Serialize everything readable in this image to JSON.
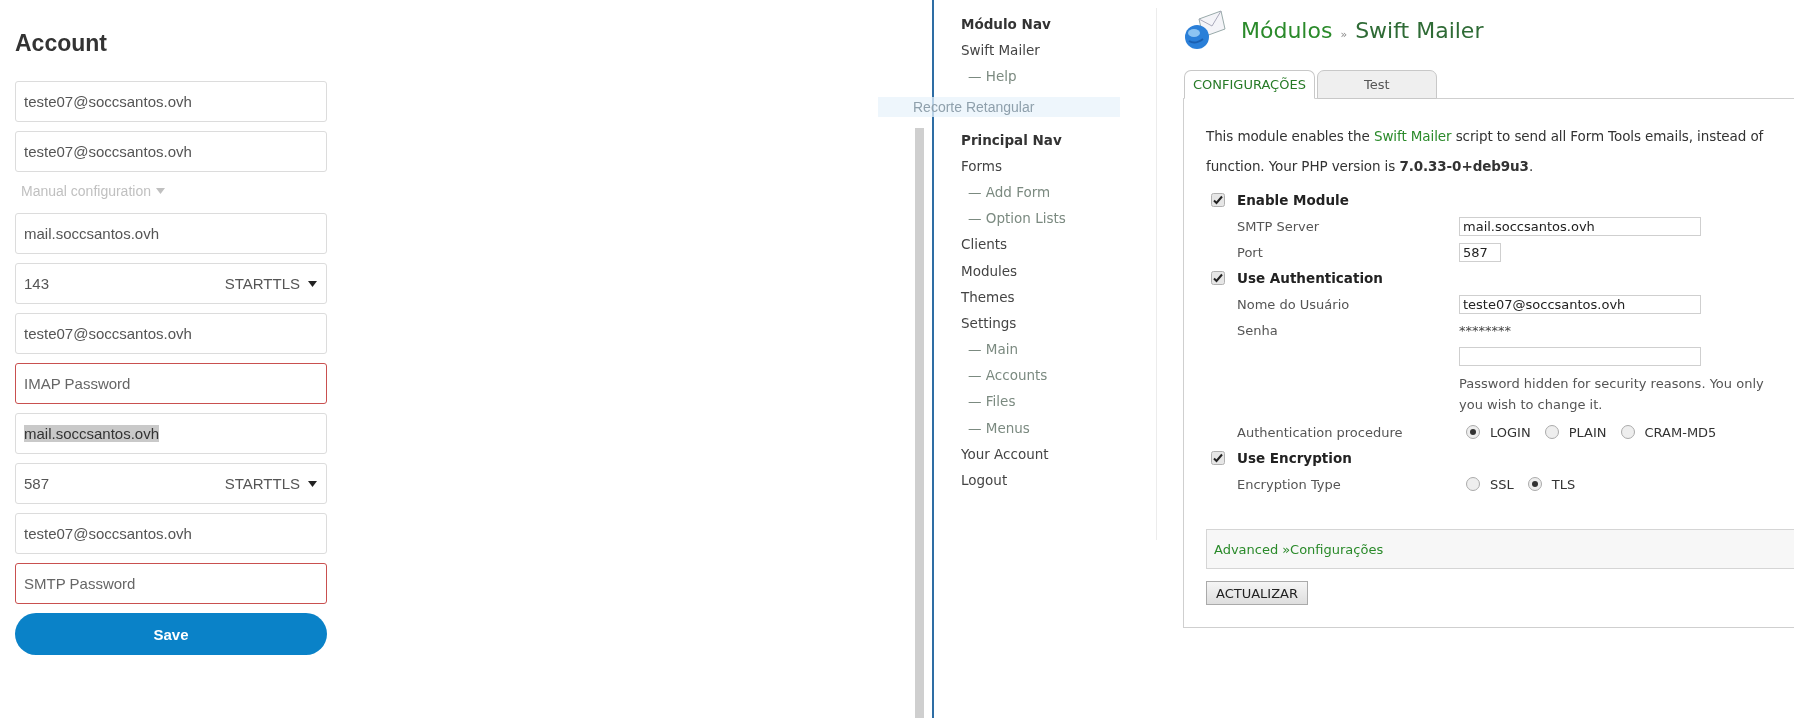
{
  "account": {
    "title": "Account",
    "fields": [
      {
        "kind": "text",
        "value": "teste07@soccsantos.ovh",
        "invalid": false,
        "highlighted": false
      },
      {
        "kind": "text",
        "value": "teste07@soccsantos.ovh",
        "invalid": false,
        "highlighted": false
      },
      {
        "kind": "toggle",
        "label": "Manual configuration"
      },
      {
        "kind": "text",
        "value": "mail.soccsantos.ovh",
        "invalid": false,
        "highlighted": false
      },
      {
        "kind": "port",
        "value": "143",
        "security": "STARTTLS",
        "invalid": false,
        "highlighted": false
      },
      {
        "kind": "text",
        "value": "teste07@soccsantos.ovh",
        "invalid": false,
        "highlighted": false
      },
      {
        "kind": "password",
        "placeholder": "IMAP Password",
        "invalid": true
      },
      {
        "kind": "text",
        "value": "mail.soccsantos.ovh",
        "invalid": false,
        "highlighted": true
      },
      {
        "kind": "port",
        "value": "587",
        "security": "STARTTLS",
        "invalid": false,
        "highlighted": false
      },
      {
        "kind": "text",
        "value": "teste07@soccsantos.ovh",
        "invalid": false,
        "highlighted": false
      },
      {
        "kind": "password",
        "placeholder": "SMTP Password",
        "invalid": true
      }
    ],
    "save_button": "Save"
  },
  "overlay_tooltip": {
    "text": "Recorte Retangular"
  },
  "nav": {
    "sections": [
      {
        "heading": "Módulo Nav",
        "items": [
          {
            "label": "Swift Mailer",
            "children": [
              {
                "label": "— Help"
              }
            ]
          }
        ]
      },
      {
        "heading": "Principal Nav",
        "items": [
          {
            "label": "Forms",
            "children": [
              {
                "label": "— Add Form"
              },
              {
                "label": "— Option Lists"
              }
            ]
          },
          {
            "label": "Clients"
          },
          {
            "label": "Modules"
          },
          {
            "label": "Themes"
          },
          {
            "label": "Settings",
            "children": [
              {
                "label": "— Main"
              },
              {
                "label": "— Accounts"
              },
              {
                "label": "— Files"
              },
              {
                "label": "— Menus"
              }
            ]
          },
          {
            "label": "Your Account"
          },
          {
            "label": "Logout"
          }
        ]
      }
    ]
  },
  "header": {
    "section": "Módulos",
    "separator": "»",
    "title": "Swift Mailer"
  },
  "tabs": [
    {
      "label": "CONFIGURAÇÕES",
      "selected": true
    },
    {
      "label": "Test",
      "selected": false
    }
  ],
  "intro": {
    "before": "This module enables the ",
    "link": "Swift Mailer",
    "after": " script to send all Form Tools emails, instead of",
    "line2": "function. Your PHP version is **7.0.33-0+deb9u3**."
  },
  "settings": [
    {
      "kind": "checkbox",
      "label": "Enable Module",
      "checked": true
    },
    {
      "kind": "input",
      "label": "SMTP Server",
      "value": "mail.soccsantos.ovh"
    },
    {
      "kind": "short_input",
      "label": "Port",
      "value": "587"
    },
    {
      "kind": "checkbox",
      "label": "Use Authentication",
      "checked": true
    },
    {
      "kind": "input",
      "label": "Nome do Usuário",
      "value": "teste07@soccsantos.ovh"
    },
    {
      "kind": "password",
      "label": "Senha",
      "mask": "********",
      "hint": [
        "Password hidden for security reasons. You only",
        "you wish to change it."
      ]
    },
    {
      "kind": "radio",
      "label": "Authentication procedure",
      "options": [
        {
          "label": "LOGIN",
          "selected": true
        },
        {
          "label": "PLAIN",
          "selected": false
        },
        {
          "label": "CRAM-MD5",
          "selected": false
        }
      ]
    },
    {
      "kind": "checkbox",
      "label": "Use Encryption",
      "checked": true
    },
    {
      "kind": "radio",
      "label": "Encryption Type",
      "options": [
        {
          "label": "SSL",
          "selected": false
        },
        {
          "label": "TLS",
          "selected": true
        }
      ]
    }
  ],
  "advanced_link": "Advanced »Configurações",
  "update_button": "ACTUALIZAR"
}
